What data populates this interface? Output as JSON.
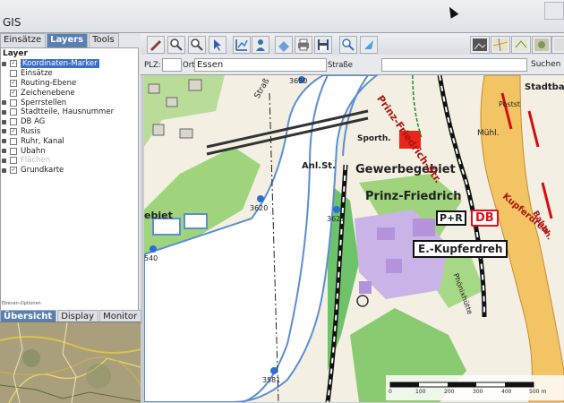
{
  "app": {
    "title": "GIS"
  },
  "left_tabs": [
    {
      "label": "Einsätze",
      "active": false
    },
    {
      "label": "Layers",
      "active": true
    },
    {
      "label": "Tools",
      "active": false
    }
  ],
  "layers": {
    "header": "Layer",
    "items": [
      {
        "label": "Koordinaten-Marker",
        "checked": true,
        "selected": true,
        "dim": false
      },
      {
        "label": "Einsätze",
        "checked": false,
        "selected": false,
        "dim": false
      },
      {
        "label": "Routing-Ebene",
        "checked": true,
        "selected": false,
        "dim": false
      },
      {
        "label": "Zeichenebene",
        "checked": true,
        "selected": false,
        "dim": false
      },
      {
        "label": "Sperrstellen",
        "checked": false,
        "selected": false,
        "dim": false
      },
      {
        "label": "Stadtteile, Hausnummer",
        "checked": false,
        "selected": false,
        "dim": false
      },
      {
        "label": "DB AG",
        "checked": false,
        "selected": false,
        "dim": false
      },
      {
        "label": "Rusis",
        "checked": true,
        "selected": false,
        "dim": false
      },
      {
        "label": "Ruhr, Kanal",
        "checked": false,
        "selected": false,
        "dim": false
      },
      {
        "label": "Ubahn",
        "checked": false,
        "selected": false,
        "dim": false
      },
      {
        "label": "Flächen",
        "checked": false,
        "selected": false,
        "dim": true
      },
      {
        "label": "Grundkarte",
        "checked": true,
        "selected": false,
        "dim": false
      }
    ],
    "options_label": "Ebenen-Optionen"
  },
  "bottom_tabs": [
    {
      "label": "Übersicht",
      "active": true
    },
    {
      "label": "Display",
      "active": false
    },
    {
      "label": "Monitor",
      "active": false
    }
  ],
  "search": {
    "plz_label": "PLZ:",
    "plz_value": "",
    "ort_label": "Ort:",
    "ort_value": "Essen",
    "strasse_label": "Straße",
    "strasse_value": "",
    "search_button": "Suchen"
  },
  "map": {
    "street_labels": {
      "street_left": "Straß",
      "gewerbegebiet": "Gewerbegebiet",
      "prinz_friedrich": "Prinz-Friedrich",
      "anl_st": "Anl.St.",
      "sporth": "Sporth.",
      "gebiet": "ebiet",
      "prinz_friedrich_str": "Prinz-Friedrich-Str.",
      "postst": "Postst",
      "bahnhof": "Bahnh.",
      "stadtbad": "Stadtbad",
      "kupferdreh": "Kupferdreh",
      "muehl": "Mühl.",
      "phoenixhutte": "Phönixhütte"
    },
    "markers": [
      {
        "label": "3650"
      },
      {
        "label": "3620"
      },
      {
        "label": "3621"
      },
      {
        "label": "540"
      },
      {
        "label": "3581"
      }
    ],
    "station_label": "E.-Kupferdreh",
    "db_badge": "DB",
    "pr_badge": "P+R",
    "scale_ticks": [
      "0",
      "100",
      "200",
      "300",
      "400",
      "500 m"
    ]
  },
  "colors": {
    "water": "#ffffff",
    "water_edge": "#5b8fd0",
    "green": "#9ed77a",
    "purple": "#c7b2e6",
    "railway": "#111111",
    "road_major": "#f2c463",
    "tab_active": "#5a7fb4"
  }
}
